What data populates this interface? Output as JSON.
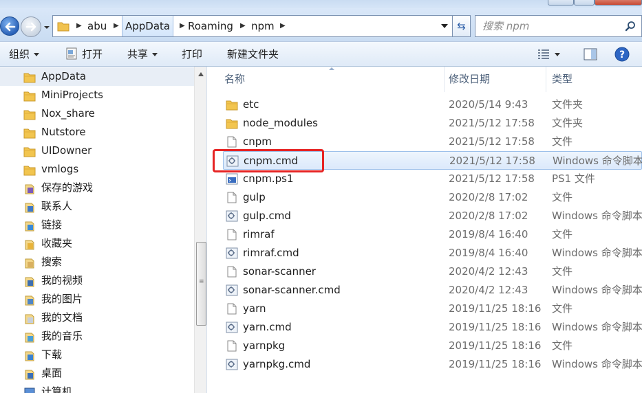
{
  "breadcrumbs": [
    "abu",
    "AppData",
    "Roaming",
    "npm"
  ],
  "search": {
    "placeholder": "搜索 npm"
  },
  "toolbar": {
    "organize_label": "组织",
    "open_label": "打开",
    "share_label": "共享",
    "print_label": "打印",
    "new_folder_label": "新建文件夹"
  },
  "sidebar": {
    "items": [
      {
        "label": "AppData",
        "icon": "folder-icon"
      },
      {
        "label": "MiniProjects",
        "icon": "folder-icon"
      },
      {
        "label": "Nox_share",
        "icon": "folder-icon"
      },
      {
        "label": "Nutstore",
        "icon": "folder-icon"
      },
      {
        "label": "UIDowner",
        "icon": "folder-icon"
      },
      {
        "label": "vmlogs",
        "icon": "folder-icon"
      },
      {
        "label": "保存的游戏",
        "icon": "games-icon"
      },
      {
        "label": "联系人",
        "icon": "contacts-icon"
      },
      {
        "label": "链接",
        "icon": "links-icon"
      },
      {
        "label": "收藏夹",
        "icon": "favorites-icon"
      },
      {
        "label": "搜索",
        "icon": "search-folder-icon"
      },
      {
        "label": "我的视频",
        "icon": "videos-icon"
      },
      {
        "label": "我的图片",
        "icon": "pictures-icon"
      },
      {
        "label": "我的文档",
        "icon": "documents-icon"
      },
      {
        "label": "我的音乐",
        "icon": "music-icon"
      },
      {
        "label": "下载",
        "icon": "downloads-icon"
      },
      {
        "label": "桌面",
        "icon": "desktop-icon"
      },
      {
        "label": "计算机",
        "icon": "computer-icon"
      }
    ]
  },
  "columns": {
    "name": "名称",
    "modified": "修改日期",
    "type": "类型"
  },
  "files": [
    {
      "name": "etc",
      "modified": "2020/5/14 9:43",
      "type": "文件夹",
      "icon": "folder-icon"
    },
    {
      "name": "node_modules",
      "modified": "2021/5/12 17:58",
      "type": "文件夹",
      "icon": "folder-icon"
    },
    {
      "name": "cnpm",
      "modified": "2021/5/12 17:58",
      "type": "文件",
      "icon": "file-icon"
    },
    {
      "name": "cnpm.cmd",
      "modified": "2021/5/12 17:58",
      "type": "Windows 命令脚本",
      "icon": "cmd-script-icon"
    },
    {
      "name": "cnpm.ps1",
      "modified": "2021/5/12 17:58",
      "type": "PS1 文件",
      "icon": "ps1-file-icon"
    },
    {
      "name": "gulp",
      "modified": "2020/2/8 17:02",
      "type": "文件",
      "icon": "file-icon"
    },
    {
      "name": "gulp.cmd",
      "modified": "2020/2/8 17:02",
      "type": "Windows 命令脚本",
      "icon": "cmd-script-icon"
    },
    {
      "name": "rimraf",
      "modified": "2019/8/4 16:40",
      "type": "文件",
      "icon": "file-icon"
    },
    {
      "name": "rimraf.cmd",
      "modified": "2019/8/4 16:40",
      "type": "Windows 命令脚本",
      "icon": "cmd-script-icon"
    },
    {
      "name": "sonar-scanner",
      "modified": "2020/4/2 12:43",
      "type": "文件",
      "icon": "file-icon"
    },
    {
      "name": "sonar-scanner.cmd",
      "modified": "2020/4/2 12:43",
      "type": "Windows 命令脚本",
      "icon": "cmd-script-icon"
    },
    {
      "name": "yarn",
      "modified": "2019/11/25 18:16",
      "type": "文件",
      "icon": "file-icon"
    },
    {
      "name": "yarn.cmd",
      "modified": "2019/11/25 18:16",
      "type": "Windows 命令脚本",
      "icon": "cmd-script-icon"
    },
    {
      "name": "yarnpkg",
      "modified": "2019/11/25 18:16",
      "type": "文件",
      "icon": "file-icon"
    },
    {
      "name": "yarnpkg.cmd",
      "modified": "2019/11/25 18:16",
      "type": "Windows 命令脚本",
      "icon": "cmd-script-icon"
    }
  ],
  "selected_file": "cnpm.cmd",
  "highlight_color": "#e62323"
}
